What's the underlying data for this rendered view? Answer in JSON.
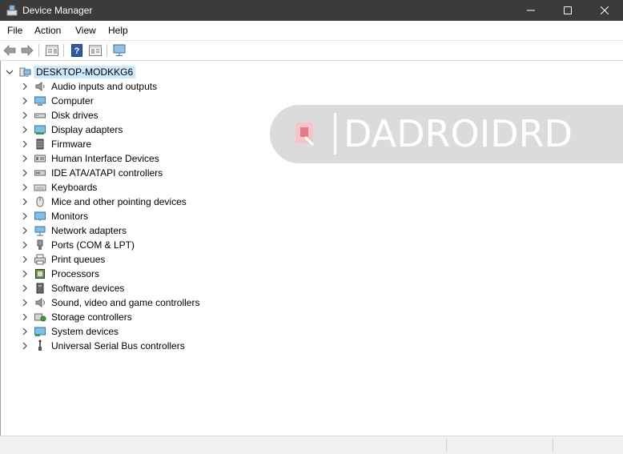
{
  "window": {
    "title": "Device Manager",
    "controls": [
      "minimize",
      "maximize",
      "close"
    ]
  },
  "menu": [
    "File",
    "Action",
    "View",
    "Help"
  ],
  "toolbar": [
    "back-arrow-icon",
    "forward-arrow-icon",
    "properties-icon",
    "help-icon",
    "list-view-icon",
    "monitor-scan-icon"
  ],
  "tree": {
    "root": "DESKTOP-MODKKG6",
    "items": [
      {
        "label": "Audio inputs and outputs",
        "icon": "speaker-icon"
      },
      {
        "label": "Computer",
        "icon": "computer-icon"
      },
      {
        "label": "Disk drives",
        "icon": "disk-drive-icon"
      },
      {
        "label": "Display adapters",
        "icon": "display-adapter-icon"
      },
      {
        "label": "Firmware",
        "icon": "firmware-icon"
      },
      {
        "label": "Human Interface Devices",
        "icon": "hid-icon"
      },
      {
        "label": "IDE ATA/ATAPI controllers",
        "icon": "ide-controller-icon"
      },
      {
        "label": "Keyboards",
        "icon": "keyboard-icon"
      },
      {
        "label": "Mice and other pointing devices",
        "icon": "mouse-icon"
      },
      {
        "label": "Monitors",
        "icon": "monitor-icon"
      },
      {
        "label": "Network adapters",
        "icon": "network-adapter-icon"
      },
      {
        "label": "Ports (COM & LPT)",
        "icon": "port-icon"
      },
      {
        "label": "Print queues",
        "icon": "printer-icon"
      },
      {
        "label": "Processors",
        "icon": "processor-icon"
      },
      {
        "label": "Software devices",
        "icon": "software-device-icon"
      },
      {
        "label": "Sound, video and game controllers",
        "icon": "sound-controller-icon"
      },
      {
        "label": "Storage controllers",
        "icon": "storage-controller-icon"
      },
      {
        "label": "System devices",
        "icon": "system-devices-icon"
      },
      {
        "label": "Universal Serial Bus controllers",
        "icon": "usb-icon"
      }
    ]
  },
  "watermark": {
    "text": "DADROIDRD"
  },
  "colors": {
    "titlebar": "#3d3a3a",
    "selection": "#cce8ff"
  }
}
